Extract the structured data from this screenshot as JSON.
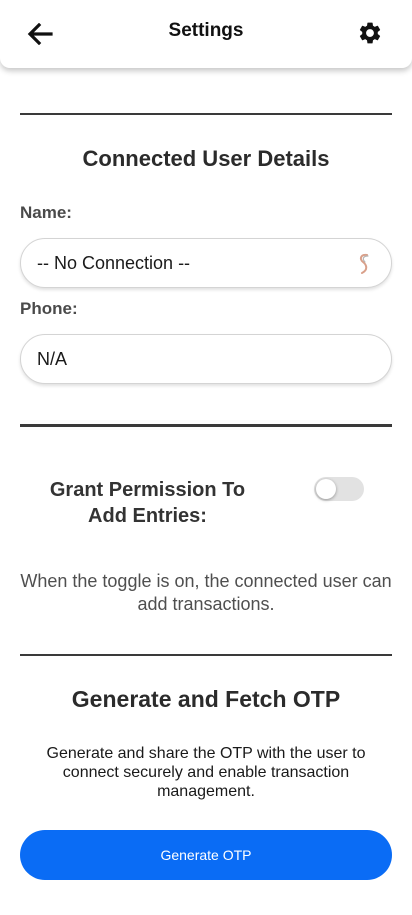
{
  "header": {
    "title": "Settings",
    "back_icon": "arrow-left-icon",
    "settings_icon": "gear-icon"
  },
  "connected_user": {
    "section_title": "Connected User Details",
    "name_label": "Name:",
    "name_value": "-- No Connection --",
    "phone_label": "Phone:",
    "phone_value": "N/A"
  },
  "permission": {
    "label": "Grant Permission To Add Entries:",
    "toggle_on": false,
    "hint": "When the toggle is on, the connected user can add transactions."
  },
  "otp": {
    "section_title": "Generate and Fetch OTP",
    "description": "Generate and share the OTP with the user to connect securely and enable transaction management.",
    "button_label": "Generate OTP"
  },
  "colors": {
    "accent": "#0a6cf5",
    "toggle_track": "#e2e2e2"
  }
}
